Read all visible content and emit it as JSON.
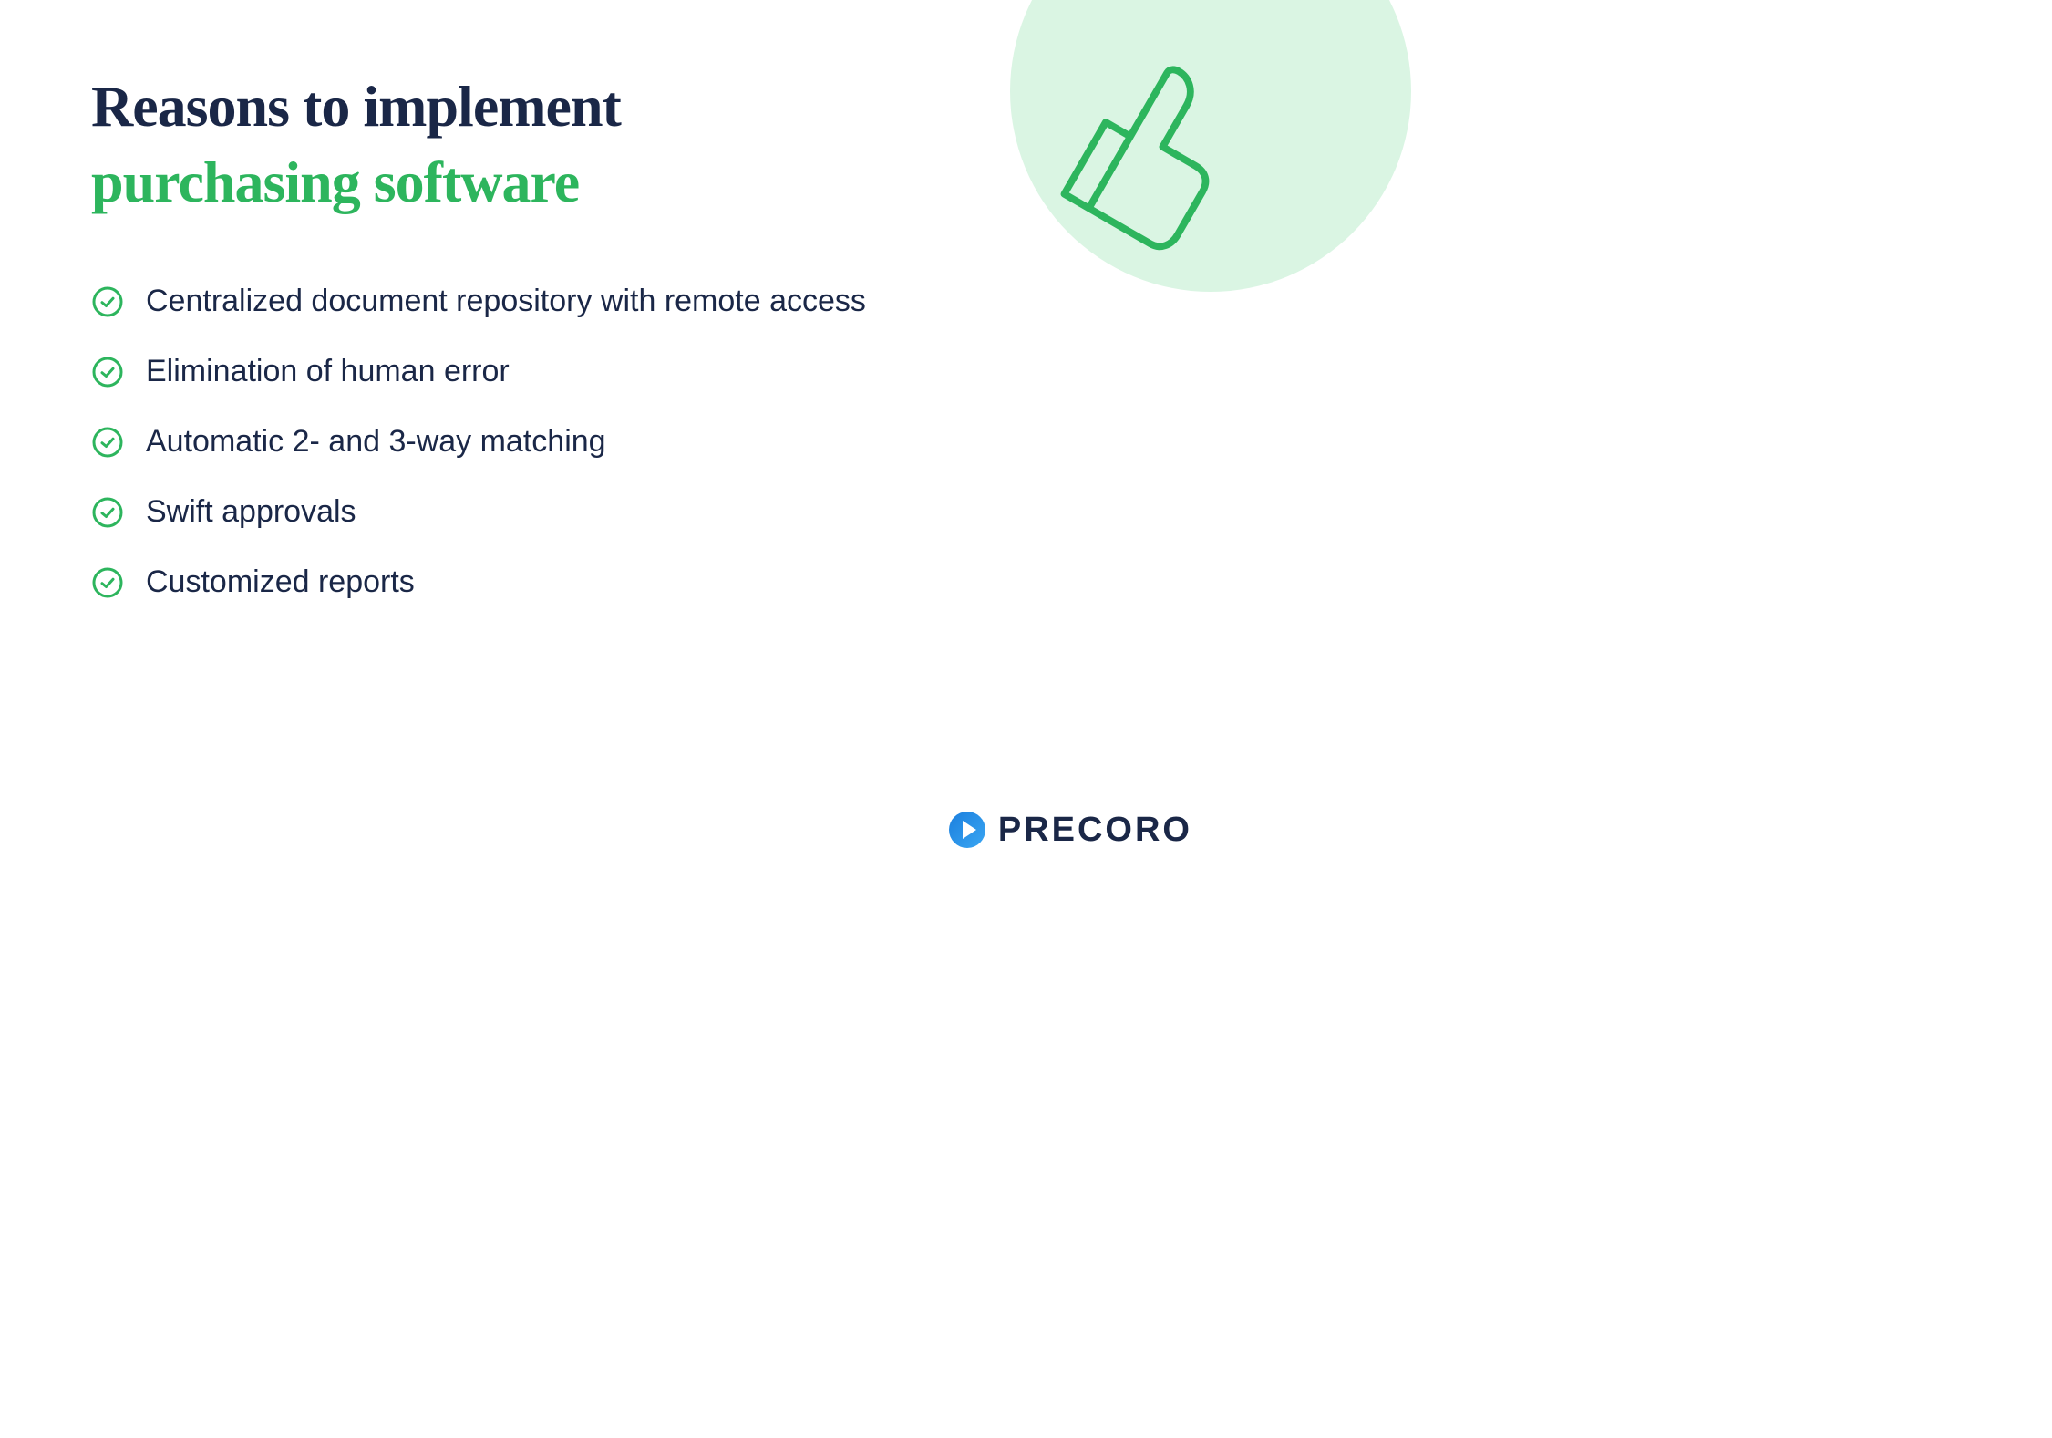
{
  "title": {
    "line1": "Reasons to implement",
    "line2": "purchasing software"
  },
  "reasons": [
    "Centralized document repository with remote access",
    "Elimination of human error",
    "Automatic 2- and 3-way matching",
    "Swift approvals",
    "Customized reports"
  ],
  "brand": "PRECORO",
  "colors": {
    "dark": "#1a2747",
    "green": "#2db55d",
    "lightGreen": "#daf5e3"
  }
}
